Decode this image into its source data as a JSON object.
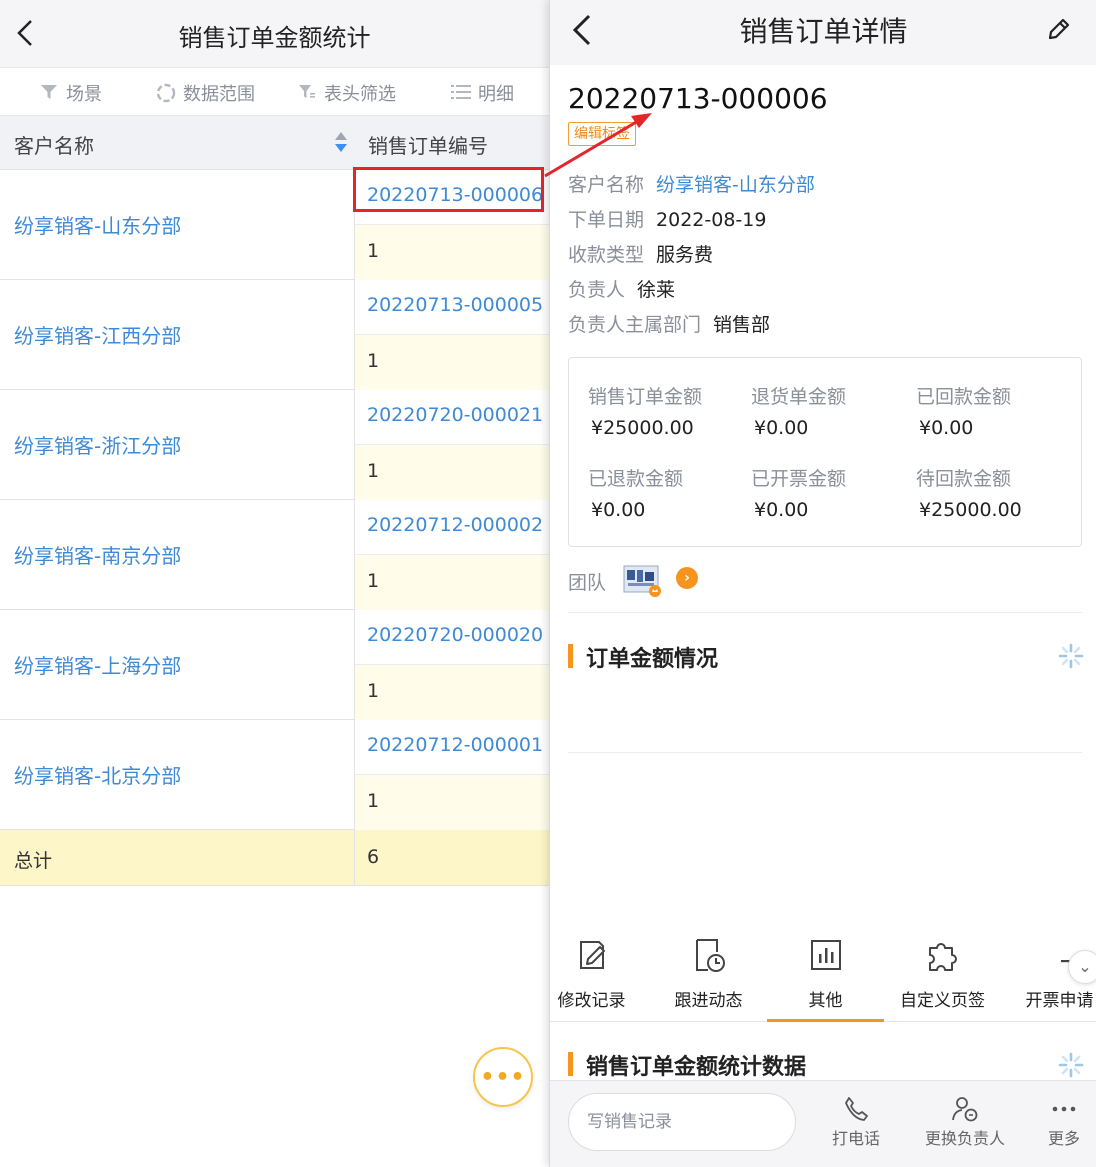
{
  "left": {
    "title": "销售订单金额统计",
    "toolbar": [
      "场景",
      "数据范围",
      "表头筛选",
      "明细"
    ],
    "columns": [
      "客户名称",
      "销售订单编号"
    ],
    "rows": [
      {
        "customer": "纷享销客-山东分部",
        "order": "20220713-000006",
        "count": "1"
      },
      {
        "customer": "纷享销客-江西分部",
        "order": "20220713-000005",
        "count": "1"
      },
      {
        "customer": "纷享销客-浙江分部",
        "order": "20220720-000021",
        "count": "1"
      },
      {
        "customer": "纷享销客-南京分部",
        "order": "20220712-000002",
        "count": "1"
      },
      {
        "customer": "纷享销客-上海分部",
        "order": "20220720-000020",
        "count": "1"
      },
      {
        "customer": "纷享销客-北京分部",
        "order": "20220712-000001",
        "count": "1"
      }
    ],
    "total": {
      "label": "总计",
      "value": "6"
    }
  },
  "right": {
    "title": "销售订单详情",
    "order_no": "20220713-000006",
    "tag": "编辑标签",
    "info": [
      {
        "label": "客户名称",
        "value": "纷享销客-山东分部",
        "link": true
      },
      {
        "label": "下单日期",
        "value": "2022-08-19",
        "link": false
      },
      {
        "label": "收款类型",
        "value": "服务费",
        "link": false
      },
      {
        "label": "负责人",
        "value": "徐莱",
        "link": false
      },
      {
        "label": "负责人主属部门",
        "value": "销售部",
        "link": false
      }
    ],
    "amounts": [
      {
        "label": "销售订单金额",
        "value": "¥25000.00"
      },
      {
        "label": "退货单金额",
        "value": "¥0.00"
      },
      {
        "label": "已回款金额",
        "value": "¥0.00"
      },
      {
        "label": "已退款金额",
        "value": "¥0.00"
      },
      {
        "label": "已开票金额",
        "value": "¥0.00"
      },
      {
        "label": "待回款金额",
        "value": "¥25000.00"
      }
    ],
    "team_label": "团队",
    "section1": "订单金额情况",
    "tabs": [
      "修改记录",
      "跟进动态",
      "其他",
      "自定义页签",
      "开票申请"
    ],
    "section2": "销售订单金额统计数据",
    "write_placeholder": "写销售记录",
    "bottom_actions": [
      "打电话",
      "更换负责人",
      "更多"
    ]
  },
  "colors": {
    "accent": "#f7941e",
    "link": "#3e8ad6",
    "highlight": "#e5252a"
  }
}
